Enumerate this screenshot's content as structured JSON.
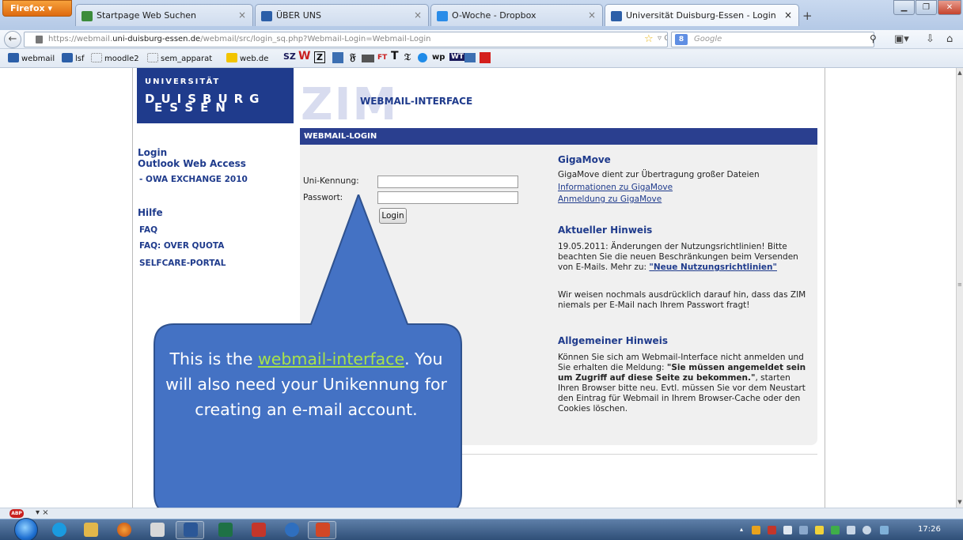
{
  "browser": {
    "menu_button": "Firefox",
    "tabs": [
      {
        "title": "Startpage Web Suchen",
        "color": "#3c8c3c"
      },
      {
        "title": "ÜBER UNS",
        "color": "#2c5fa8"
      },
      {
        "title": "O-Woche - Dropbox",
        "color": "#2a8ce8"
      },
      {
        "title": "Universität Duisburg-Essen - Login",
        "color": "#2c5fa8"
      }
    ],
    "new_tab": "+",
    "url_prefix": "https://webmail.",
    "url_domain": "uni-duisburg-essen.de",
    "url_path": "/webmail/src/login_sq.php?Webmail-Login=Webmail-Login",
    "search_placeholder": "Google",
    "search_engine_badge": "8"
  },
  "bookmarks": [
    {
      "label": "webmail",
      "color": "#2c5fa8"
    },
    {
      "label": "lsf",
      "color": "#2c5fa8"
    },
    {
      "label": "moodle2",
      "color": "#ffffff"
    },
    {
      "label": "sem_apparat",
      "color": "#ffffff"
    },
    {
      "label": "web.de",
      "color": "#f2c400"
    }
  ],
  "bookmark_glyphs": [
    "SZ",
    "W",
    "Z",
    "FT",
    "T",
    "wp",
    "WT"
  ],
  "page": {
    "logo_top": "UNIVERSITÄT",
    "logo_main": "DUISBURG",
    "logo_sub": "ESSEN",
    "zim_watermark": "ZIM",
    "app_title": "WEBMAIL-INTERFACE",
    "login_header": "WEBMAIL-LOGIN",
    "sidebar": {
      "login": "Login",
      "outlook": "Outlook Web Access",
      "owa": "- OWA EXCHANGE 2010",
      "hilfe": "Hilfe",
      "faq": "FAQ",
      "faq_quota": "FAQ: OVER QUOTA",
      "selfcare": "SELFCARE-PORTAL"
    },
    "form": {
      "user_label": "Uni-Kennung:",
      "user_value": "",
      "password_label": "Passwort:",
      "password_value": "",
      "login_button": "Login"
    },
    "gigamove": {
      "heading": "GigaMove",
      "text": "GigaMove dient zur Übertragung großer Dateien",
      "link_info": "Informationen zu GigaMove",
      "link_signup": "Anmeldung zu GigaMove"
    },
    "aktuell": {
      "heading": "Aktueller Hinweis",
      "text": "19.05.2011: Änderungen der Nutzungsrichtlinien! Bitte beachten Sie die neuen Beschränkungen beim Versenden von E-Mails. Mehr zu: ",
      "link": "\"Neue Nutzungsrichtlinien\"",
      "text2": "Wir weisen nochmals ausdrücklich darauf hin, dass das ZIM niemals per E-Mail nach Ihrem Passwort fragt!"
    },
    "allgemein": {
      "heading": "Allgemeiner Hinweis",
      "text_a": "Können Sie sich am Webmail-Interface nicht anmelden und Sie erhalten die Meldung: ",
      "strong": "\"Sie müssen angemeldet sein um Zugriff auf diese Seite zu bekommen.\"",
      "text_b": ", starten Ihren Browser bitte neu. Evtl. müssen Sie vor dem Neustart den Eintrag für Webmail in Ihrem Browser-Cache oder den Cookies löschen."
    }
  },
  "callout": {
    "pre": "This is the ",
    "link": "webmail-interface",
    "post": ". You will also need your Unikennung for creating an e-mail account."
  },
  "taskbar": {
    "clock": "17:26"
  },
  "colors": {
    "uni_blue": "#1f3b8c",
    "header_blue": "#2a3f8f",
    "callout_fill": "#4472c4",
    "callout_link": "#a8e24a"
  }
}
